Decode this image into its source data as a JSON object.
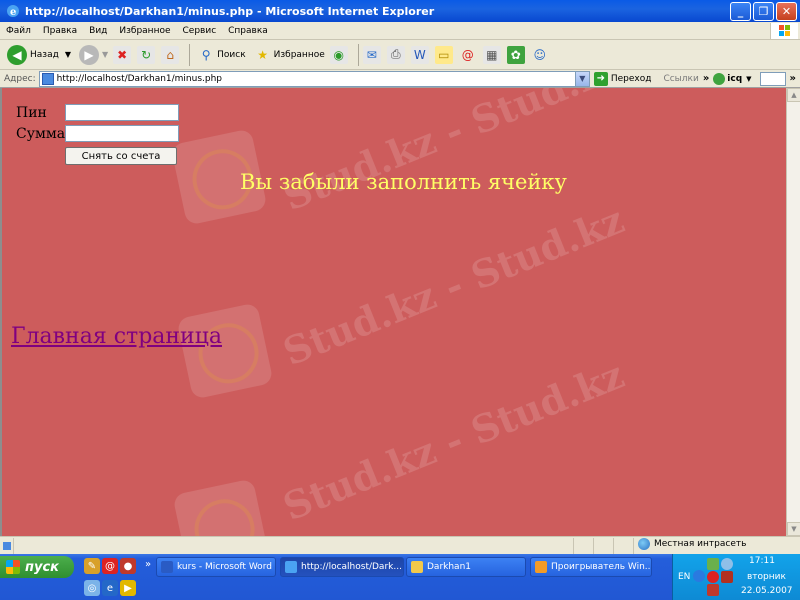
{
  "window": {
    "title": "http://localhost/Darkhan1/minus.php - Microsoft Internet Explorer",
    "buttons": {
      "minimize": "_",
      "maximize": "❐",
      "close": "✕"
    }
  },
  "menu": [
    "Файл",
    "Правка",
    "Вид",
    "Избранное",
    "Сервис",
    "Справка"
  ],
  "toolbar": {
    "back_label": "Назад",
    "search_label": "Поиск",
    "favorites_label": "Избранное"
  },
  "address": {
    "label": "Адрес:",
    "url": "http://localhost/Darkhan1/minus.php",
    "go_label": "Переход",
    "links_label": "Ссылки",
    "icq_label": "icq"
  },
  "page": {
    "background": "#cd5c5c",
    "pin_label": "Пин",
    "pin_value": "",
    "sum_label": "Сумма",
    "sum_value": "",
    "submit_label": "Снять со счета",
    "message": "Вы забыли заполнить ячейку",
    "home_link": "Главная страница",
    "watermark": "Stud.kz - Stud.kz"
  },
  "status": {
    "zone": "Местная интрасеть"
  },
  "taskbar": {
    "start_label": "пуск",
    "tasks": [
      {
        "label": "kurs - Microsoft Word"
      },
      {
        "label": "http://localhost/Dark..."
      },
      {
        "label": "Darkhan1"
      },
      {
        "label": "Проигрыватель Win..."
      }
    ],
    "tray": {
      "lang": "EN",
      "time": "17:11",
      "day": "вторник",
      "date": "22.05.2007"
    }
  }
}
